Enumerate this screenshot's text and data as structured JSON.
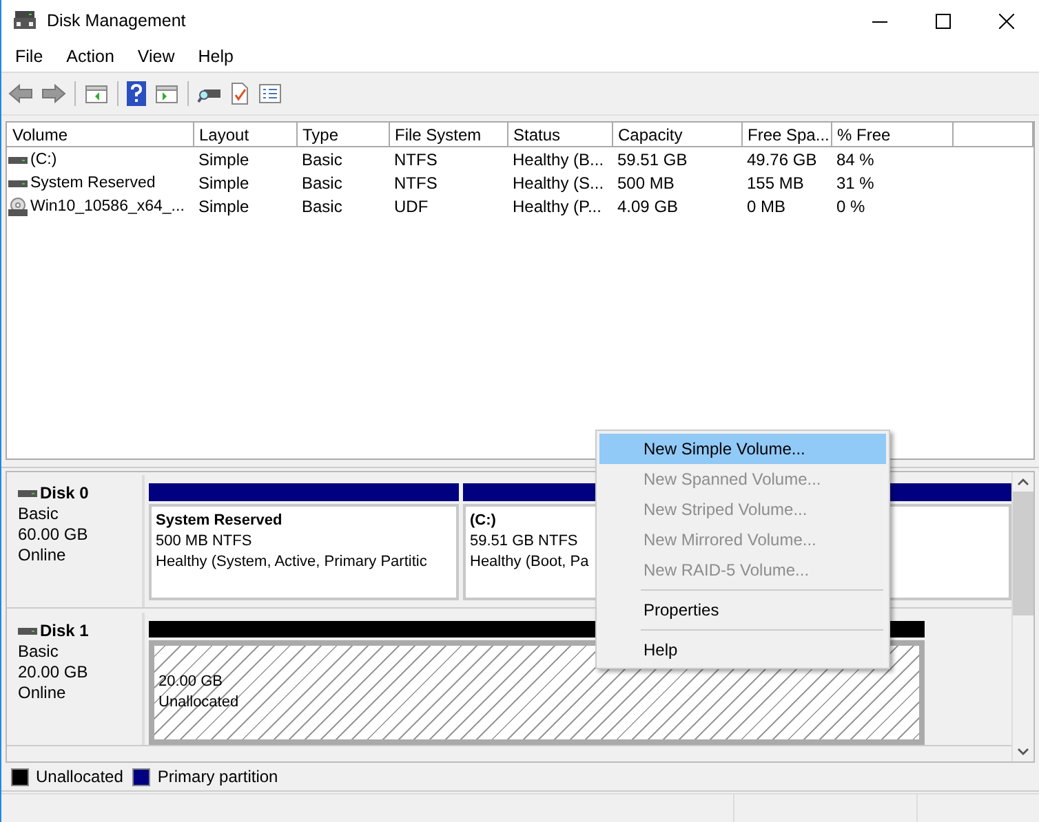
{
  "window": {
    "title": "Disk Management"
  },
  "menu": [
    "File",
    "Action",
    "View",
    "Help"
  ],
  "table": {
    "columns": [
      "Volume",
      "Layout",
      "Type",
      "File System",
      "Status",
      "Capacity",
      "Free Spa...",
      "% Free"
    ],
    "rows": [
      {
        "kind": "drive",
        "cells": [
          "(C:)",
          "Simple",
          "Basic",
          "NTFS",
          "Healthy (B...",
          "59.51 GB",
          "49.76 GB",
          "84 %"
        ]
      },
      {
        "kind": "drive",
        "cells": [
          "System Reserved",
          "Simple",
          "Basic",
          "NTFS",
          "Healthy (S...",
          "500 MB",
          "155 MB",
          "31 %"
        ]
      },
      {
        "kind": "disc",
        "cells": [
          "Win10_10586_x64_...",
          "Simple",
          "Basic",
          "UDF",
          "Healthy (P...",
          "4.09 GB",
          "0 MB",
          "0 %"
        ]
      }
    ]
  },
  "disks": [
    {
      "name": "Disk 0",
      "type": "Basic",
      "size": "60.00 GB",
      "status": "Online",
      "partitions": [
        {
          "kind": "primary",
          "selected": false,
          "title": "System Reserved",
          "detail": "500 MB NTFS",
          "status": "Healthy (System, Active, Primary Partitic"
        },
        {
          "kind": "primary",
          "selected": false,
          "title": "(C:)",
          "detail": "59.51 GB NTFS",
          "status": "Healthy (Boot, Pa"
        }
      ]
    },
    {
      "name": "Disk 1",
      "type": "Basic",
      "size": "20.00 GB",
      "status": "Online",
      "partitions": [
        {
          "kind": "unallocated",
          "selected": true,
          "detail": "20.00 GB",
          "status": "Unallocated"
        }
      ]
    }
  ],
  "legend": [
    {
      "label": "Unallocated",
      "color": "#000000"
    },
    {
      "label": "Primary partition",
      "color": "#000080"
    }
  ],
  "context_menu": [
    {
      "kind": "item",
      "label": "New Simple Volume...",
      "disabled": false,
      "selected": true
    },
    {
      "kind": "item",
      "label": "New Spanned Volume...",
      "disabled": true,
      "selected": false
    },
    {
      "kind": "item",
      "label": "New Striped Volume...",
      "disabled": true,
      "selected": false
    },
    {
      "kind": "item",
      "label": "New Mirrored Volume...",
      "disabled": true,
      "selected": false
    },
    {
      "kind": "item",
      "label": "New RAID-5 Volume...",
      "disabled": true,
      "selected": false
    },
    {
      "kind": "separator"
    },
    {
      "kind": "item",
      "label": "Properties",
      "disabled": false,
      "selected": false
    },
    {
      "kind": "separator"
    },
    {
      "kind": "item",
      "label": "Help",
      "disabled": false,
      "selected": false
    }
  ]
}
